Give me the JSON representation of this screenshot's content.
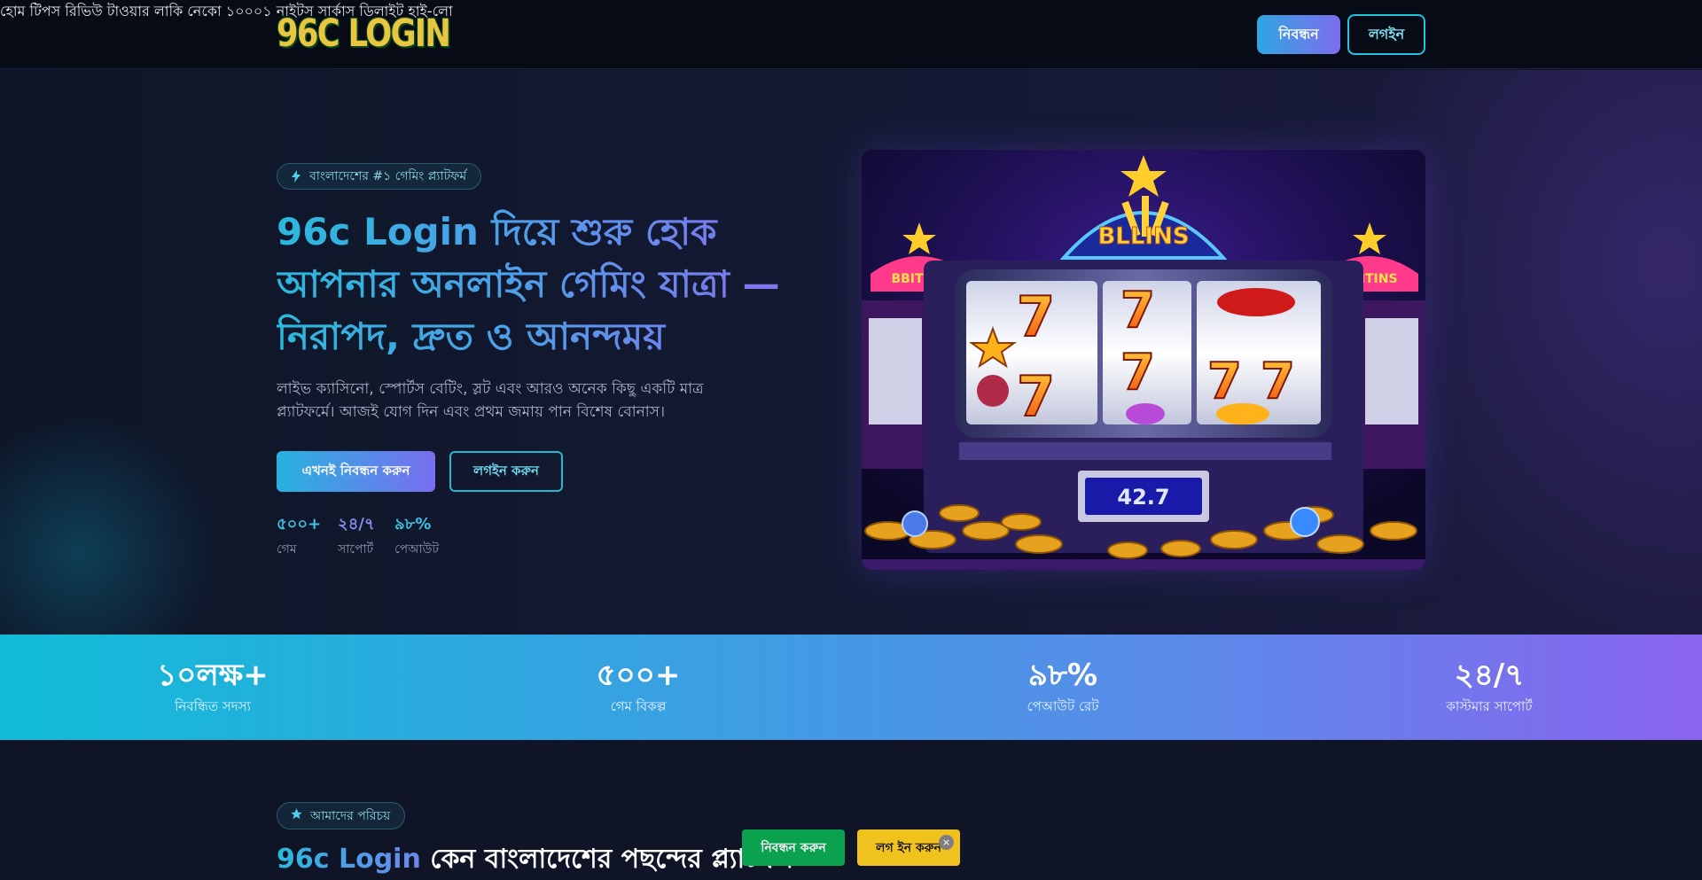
{
  "header": {
    "logo_text": "96C LOGIN",
    "nav": [
      {
        "label": "হোম"
      },
      {
        "label": "টিপস"
      },
      {
        "label": "রিভিউ"
      },
      {
        "label": "টাওয়ার"
      },
      {
        "label": "লাকি নেকো"
      },
      {
        "label": "১০০০১ নাইটস"
      },
      {
        "label": "সার্কাস ডিলাইট"
      },
      {
        "label": "হাই-লো"
      }
    ],
    "register_label": "নিবন্ধন",
    "login_label": "লগইন"
  },
  "hero": {
    "badge": "বাংলাদেশের #১ গেমিং প্ল্যাটফর্ম",
    "title": "96c Login দিয়ে শুরু হোক আপনার অনলাইন গেমিং যাত্রা — নিরাপদ, দ্রুত ও আনন্দময়",
    "description": "লাইভ ক্যাসিনো, স্পোর্টস বেটিং, স্লট এবং আরও অনেক কিছু একটি মাত্র প্ল্যাটফর্মে। আজই যোগ দিন এবং প্রথম জমায় পান বিশেষ বোনাস।",
    "register_button": "এখনই নিবন্ধন করুন",
    "login_button": "লগইন করুন",
    "mini_stats": [
      {
        "value": "৫০০+",
        "label": "গেম"
      },
      {
        "value": "২৪/৭",
        "label": "সাপোর্ট"
      },
      {
        "value": "৯৮%",
        "label": "পেআউট"
      }
    ],
    "image": {
      "sign_text": "BLLINS",
      "side_sign": "BBITINS",
      "display_value": "42.7"
    }
  },
  "stats": [
    {
      "value": "১০লক্ষ+",
      "label": "নিবন্ধিত সদস্য"
    },
    {
      "value": "৫০০+",
      "label": "গেম বিকল্প"
    },
    {
      "value": "৯৮%",
      "label": "পেআউট রেট"
    },
    {
      "value": "২৪/৭",
      "label": "কাস্টমার সাপোর্ট"
    }
  ],
  "about": {
    "badge": "আমাদের পরিচয়",
    "title_accent": "96c Login",
    "title_rest": " কেন বাংলাদেশের পছন্দের প্ল্যাটফর্ম"
  },
  "floating": {
    "register": "নিবন্ধন করুন",
    "login": "লগ ইন করুন",
    "close": "×"
  },
  "colors": {
    "accent_cyan": "#22c1dc",
    "accent_purple": "#8a63ef",
    "float_green": "#0aa14f",
    "float_yellow": "#f0c21d"
  }
}
